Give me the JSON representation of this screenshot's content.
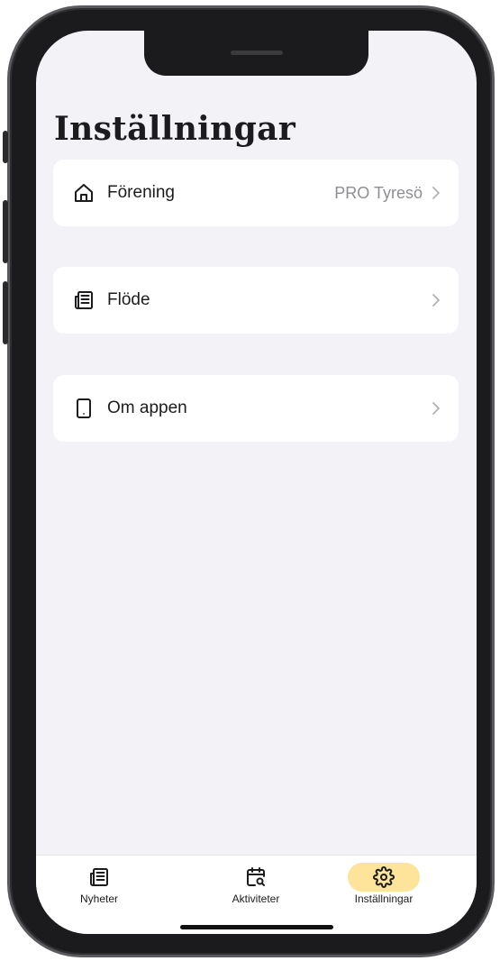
{
  "header": {
    "title": "Inställningar"
  },
  "settings": {
    "items": [
      {
        "label": "Förening",
        "value": "PRO Tyresö",
        "icon": "house-icon"
      },
      {
        "label": "Flöde",
        "value": "",
        "icon": "newspaper-icon"
      },
      {
        "label": "Om appen",
        "value": "",
        "icon": "phone-device-icon"
      }
    ]
  },
  "tabbar": {
    "tabs": [
      {
        "label": "Nyheter",
        "icon": "newspaper-icon",
        "active": false
      },
      {
        "label": "Aktiviteter",
        "icon": "calendar-search-icon",
        "active": false
      },
      {
        "label": "Inställningar",
        "icon": "gear-icon",
        "active": true
      }
    ]
  },
  "colors": {
    "background": "#f2f2f7",
    "card": "#ffffff",
    "active_tab_highlight": "#fde49a",
    "secondary_text": "#8e8e93"
  }
}
